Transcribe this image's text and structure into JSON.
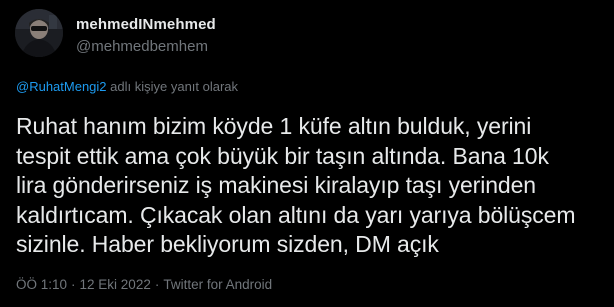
{
  "author": {
    "display_name": "mehmedINmehmed",
    "handle": "@mehmedbemhem"
  },
  "reply_context": {
    "mention": "@RuhatMengi2",
    "suffix": " adlı kişiye yanıt olarak"
  },
  "tweet": {
    "text": "Ruhat hanım bizim köyde 1 küfe altın bulduk, yerini\ntespit ettik ama çok büyük bir taşın altında. Bana 10k\nlira gönderirseniz iş makinesi kiralayıp taşı yerinden\nkaldırtıcam. Çıkacak olan altını da yarı yarıya bölüşcem\nsizinle. Haber bekliyorum sizden, DM açık"
  },
  "meta": {
    "time": "ÖÖ 1:10",
    "separator": "·",
    "date": "12 Eki 2022",
    "source": "Twitter for Android"
  },
  "colors": {
    "background": "#000000",
    "text": "#e7e9ea",
    "muted": "#71767b",
    "link": "#1d9bf0"
  }
}
